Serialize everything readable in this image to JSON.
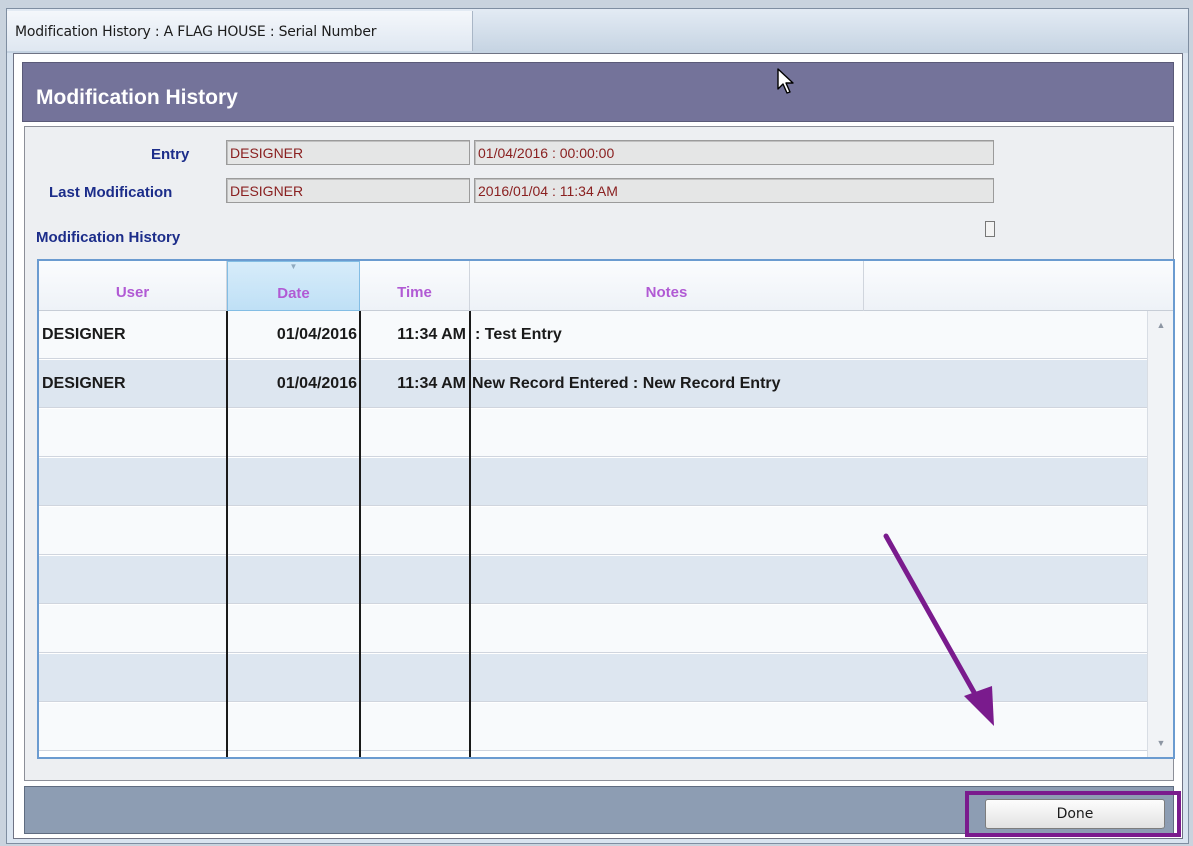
{
  "window": {
    "title": "Modification History : A FLAG HOUSE : Serial Number"
  },
  "header": {
    "title": "Modification History"
  },
  "entry": {
    "label": "Entry",
    "user": "DESIGNER",
    "datetime": "01/04/2016 : 00:00:00"
  },
  "last_modification": {
    "label": "Last Modification",
    "user": "DESIGNER",
    "datetime": "2016/01/04 : 11:34 AM"
  },
  "history": {
    "label": "Modification History",
    "columns": [
      "User",
      "Date",
      "Time",
      "Notes"
    ],
    "rows": [
      [
        "DESIGNER",
        "01/04/2016",
        "11:34 AM",
        " : Test Entry"
      ],
      [
        "DESIGNER",
        "01/04/2016",
        "11:34 AM",
        "New Record Entered  :  New Record Entry"
      ]
    ]
  },
  "footer": {
    "done_label": "Done"
  },
  "colors": {
    "header_band": "#74739a",
    "column_header_text": "#b15ad4",
    "label_text": "#1c2d8a",
    "annotation": "#7a1b8d"
  },
  "icons": [
    "mouse-cursor-icon",
    "annotation-arrow-icon",
    "scroll-up-icon",
    "scroll-down-icon",
    "sort-indicator-icon"
  ]
}
